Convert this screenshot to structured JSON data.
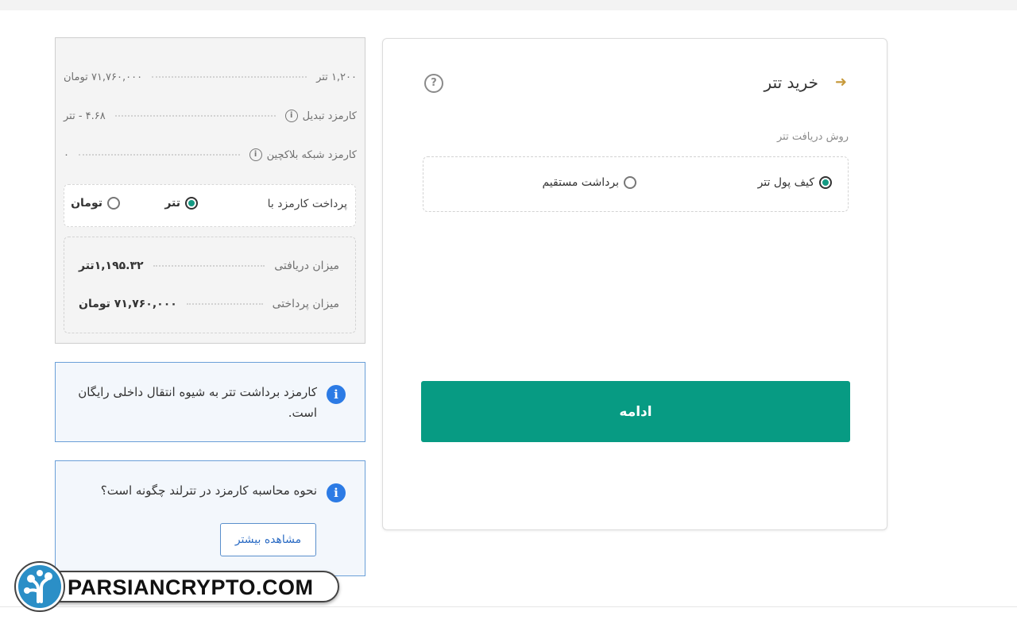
{
  "main": {
    "title": "خرید تتر",
    "receive_method_label": "روش دریافت تتر",
    "options": [
      {
        "label": "کیف پول تتر",
        "checked": true
      },
      {
        "label": "برداشت مستقیم",
        "checked": false
      }
    ],
    "continue_label": "ادامه"
  },
  "summary": {
    "amount_label": "۱,۲۰۰ تتر",
    "amount_value": "۷۱,۷۶۰,۰۰۰ تومان",
    "conversion_fee_label": "کارمزد تبدیل",
    "conversion_fee_value": "۴.۶۸ - تتر",
    "network_fee_label": "کارمزد شبکه بلاکچین",
    "network_fee_value": "۰",
    "pay_fee_label": "پرداخت کارمزد با",
    "pay_options": [
      {
        "label": "تتر",
        "checked": true
      },
      {
        "label": "تومان",
        "checked": false
      }
    ],
    "received_label": "میزان دریافتی",
    "received_value": "۱,۱۹۵.۳۲تتر",
    "paid_label": "میزان پرداختی",
    "paid_value": "۷۱,۷۶۰,۰۰۰ تومان"
  },
  "notes": {
    "free_transfer": "کارمزد برداشت تتر به شیوه انتقال داخلی رایگان است.",
    "fee_calc_question": "نحوه محاسبه کارمزد در تترلند چگونه است؟",
    "more_label": "مشاهده بیشتر"
  },
  "watermark": {
    "text": "PARSIANCRYPTO.COM"
  },
  "colors": {
    "accent": "#079b83",
    "info_blue": "#2c7be5",
    "back_arrow": "#c79a3c"
  },
  "icons": {
    "back": "arrow-right-icon",
    "help": "question-circle-icon",
    "info": "info-circle-icon"
  }
}
